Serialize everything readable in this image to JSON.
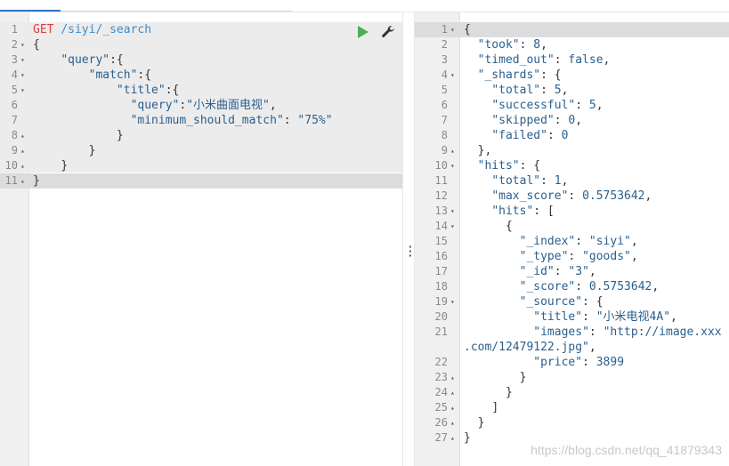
{
  "request": {
    "lines": [
      {
        "n": "1",
        "fold": "",
        "segs": [
          [
            "GET",
            "k-method"
          ],
          [
            " ",
            ""
          ],
          [
            "/siyi/_search",
            "k-url"
          ]
        ]
      },
      {
        "n": "2",
        "fold": "▾",
        "segs": [
          [
            "{",
            "k-punc"
          ]
        ]
      },
      {
        "n": "3",
        "fold": "▾",
        "segs": [
          [
            "    ",
            ""
          ],
          [
            "\"query\"",
            "k-key"
          ],
          [
            ":{",
            "k-punc"
          ]
        ]
      },
      {
        "n": "4",
        "fold": "▾",
        "segs": [
          [
            "        ",
            ""
          ],
          [
            "\"match\"",
            "k-key"
          ],
          [
            ":{",
            "k-punc"
          ]
        ]
      },
      {
        "n": "5",
        "fold": "▾",
        "segs": [
          [
            "            ",
            ""
          ],
          [
            "\"title\"",
            "k-key"
          ],
          [
            ":{",
            "k-punc"
          ]
        ]
      },
      {
        "n": "6",
        "fold": "",
        "segs": [
          [
            "              ",
            ""
          ],
          [
            "\"query\"",
            "k-key"
          ],
          [
            ":",
            "k-punc"
          ],
          [
            "\"小米曲面电视\"",
            "k-str"
          ],
          [
            ",",
            "k-punc"
          ]
        ]
      },
      {
        "n": "7",
        "fold": "",
        "segs": [
          [
            "              ",
            ""
          ],
          [
            "\"minimum_should_match\"",
            "k-key"
          ],
          [
            ": ",
            "k-punc"
          ],
          [
            "\"75%\"",
            "k-str"
          ]
        ]
      },
      {
        "n": "8",
        "fold": "▴",
        "segs": [
          [
            "            ",
            ""
          ],
          [
            "}",
            "k-punc"
          ]
        ]
      },
      {
        "n": "9",
        "fold": "▴",
        "segs": [
          [
            "        ",
            ""
          ],
          [
            "}",
            "k-punc"
          ]
        ]
      },
      {
        "n": "10",
        "fold": "▴",
        "segs": [
          [
            "    ",
            ""
          ],
          [
            "}",
            "k-punc"
          ]
        ]
      },
      {
        "n": "11",
        "fold": "▴",
        "segs": [
          [
            "}",
            "k-punc"
          ]
        ]
      }
    ]
  },
  "response": {
    "lines": [
      {
        "n": "1",
        "fold": "▾",
        "segs": [
          [
            "{",
            "k-punc"
          ]
        ]
      },
      {
        "n": "2",
        "fold": "",
        "segs": [
          [
            "  ",
            ""
          ],
          [
            "\"took\"",
            "k-key"
          ],
          [
            ": ",
            "k-punc"
          ],
          [
            "8",
            "k-num"
          ],
          [
            ",",
            "k-punc"
          ]
        ]
      },
      {
        "n": "3",
        "fold": "",
        "segs": [
          [
            "  ",
            ""
          ],
          [
            "\"timed_out\"",
            "k-key"
          ],
          [
            ": ",
            "k-punc"
          ],
          [
            "false",
            "k-bool"
          ],
          [
            ",",
            "k-punc"
          ]
        ]
      },
      {
        "n": "4",
        "fold": "▾",
        "segs": [
          [
            "  ",
            ""
          ],
          [
            "\"_shards\"",
            "k-key"
          ],
          [
            ": {",
            "k-punc"
          ]
        ]
      },
      {
        "n": "5",
        "fold": "",
        "segs": [
          [
            "    ",
            ""
          ],
          [
            "\"total\"",
            "k-key"
          ],
          [
            ": ",
            "k-punc"
          ],
          [
            "5",
            "k-num"
          ],
          [
            ",",
            "k-punc"
          ]
        ]
      },
      {
        "n": "6",
        "fold": "",
        "segs": [
          [
            "    ",
            ""
          ],
          [
            "\"successful\"",
            "k-key"
          ],
          [
            ": ",
            "k-punc"
          ],
          [
            "5",
            "k-num"
          ],
          [
            ",",
            "k-punc"
          ]
        ]
      },
      {
        "n": "7",
        "fold": "",
        "segs": [
          [
            "    ",
            ""
          ],
          [
            "\"skipped\"",
            "k-key"
          ],
          [
            ": ",
            "k-punc"
          ],
          [
            "0",
            "k-num"
          ],
          [
            ",",
            "k-punc"
          ]
        ]
      },
      {
        "n": "8",
        "fold": "",
        "segs": [
          [
            "    ",
            ""
          ],
          [
            "\"failed\"",
            "k-key"
          ],
          [
            ": ",
            "k-punc"
          ],
          [
            "0",
            "k-num"
          ]
        ]
      },
      {
        "n": "9",
        "fold": "▴",
        "segs": [
          [
            "  ",
            ""
          ],
          [
            "},",
            "k-punc"
          ]
        ]
      },
      {
        "n": "10",
        "fold": "▾",
        "segs": [
          [
            "  ",
            ""
          ],
          [
            "\"hits\"",
            "k-key"
          ],
          [
            ": {",
            "k-punc"
          ]
        ]
      },
      {
        "n": "11",
        "fold": "",
        "segs": [
          [
            "    ",
            ""
          ],
          [
            "\"total\"",
            "k-key"
          ],
          [
            ": ",
            "k-punc"
          ],
          [
            "1",
            "k-num"
          ],
          [
            ",",
            "k-punc"
          ]
        ]
      },
      {
        "n": "12",
        "fold": "",
        "segs": [
          [
            "    ",
            ""
          ],
          [
            "\"max_score\"",
            "k-key"
          ],
          [
            ": ",
            "k-punc"
          ],
          [
            "0.5753642",
            "k-num"
          ],
          [
            ",",
            "k-punc"
          ]
        ]
      },
      {
        "n": "13",
        "fold": "▾",
        "segs": [
          [
            "    ",
            ""
          ],
          [
            "\"hits\"",
            "k-key"
          ],
          [
            ": [",
            "k-punc"
          ]
        ]
      },
      {
        "n": "14",
        "fold": "▾",
        "segs": [
          [
            "      ",
            ""
          ],
          [
            "{",
            "k-punc"
          ]
        ]
      },
      {
        "n": "15",
        "fold": "",
        "segs": [
          [
            "        ",
            ""
          ],
          [
            "\"_index\"",
            "k-key"
          ],
          [
            ": ",
            "k-punc"
          ],
          [
            "\"siyi\"",
            "k-str"
          ],
          [
            ",",
            "k-punc"
          ]
        ]
      },
      {
        "n": "16",
        "fold": "",
        "segs": [
          [
            "        ",
            ""
          ],
          [
            "\"_type\"",
            "k-key"
          ],
          [
            ": ",
            "k-punc"
          ],
          [
            "\"goods\"",
            "k-str"
          ],
          [
            ",",
            "k-punc"
          ]
        ]
      },
      {
        "n": "17",
        "fold": "",
        "segs": [
          [
            "        ",
            ""
          ],
          [
            "\"_id\"",
            "k-key"
          ],
          [
            ": ",
            "k-punc"
          ],
          [
            "\"3\"",
            "k-str"
          ],
          [
            ",",
            "k-punc"
          ]
        ]
      },
      {
        "n": "18",
        "fold": "",
        "segs": [
          [
            "        ",
            ""
          ],
          [
            "\"_score\"",
            "k-key"
          ],
          [
            ": ",
            "k-punc"
          ],
          [
            "0.5753642",
            "k-num"
          ],
          [
            ",",
            "k-punc"
          ]
        ]
      },
      {
        "n": "19",
        "fold": "▾",
        "segs": [
          [
            "        ",
            ""
          ],
          [
            "\"_source\"",
            "k-key"
          ],
          [
            ": {",
            "k-punc"
          ]
        ]
      },
      {
        "n": "20",
        "fold": "",
        "segs": [
          [
            "          ",
            ""
          ],
          [
            "\"title\"",
            "k-key"
          ],
          [
            ": ",
            "k-punc"
          ],
          [
            "\"小米电视4A\"",
            "k-str"
          ],
          [
            ",",
            "k-punc"
          ]
        ]
      },
      {
        "n": "21",
        "fold": "",
        "segs": [
          [
            "          ",
            ""
          ],
          [
            "\"images\"",
            "k-key"
          ],
          [
            ": ",
            "k-punc"
          ],
          [
            "\"http://image.xxx",
            "k-str"
          ]
        ]
      },
      {
        "n": "",
        "fold": "",
        "segs": [
          [
            ".com/12479122.jpg\"",
            "k-str"
          ],
          [
            ",",
            "k-punc"
          ]
        ]
      },
      {
        "n": "22",
        "fold": "",
        "segs": [
          [
            "          ",
            ""
          ],
          [
            "\"price\"",
            "k-key"
          ],
          [
            ": ",
            "k-punc"
          ],
          [
            "3899",
            "k-num"
          ]
        ]
      },
      {
        "n": "23",
        "fold": "▴",
        "segs": [
          [
            "        ",
            ""
          ],
          [
            "}",
            "k-punc"
          ]
        ]
      },
      {
        "n": "24",
        "fold": "▴",
        "segs": [
          [
            "      ",
            ""
          ],
          [
            "}",
            "k-punc"
          ]
        ]
      },
      {
        "n": "25",
        "fold": "▴",
        "segs": [
          [
            "    ",
            ""
          ],
          [
            "]",
            "k-punc"
          ]
        ]
      },
      {
        "n": "26",
        "fold": "▴",
        "segs": [
          [
            "  ",
            ""
          ],
          [
            "}",
            "k-punc"
          ]
        ]
      },
      {
        "n": "27",
        "fold": "▴",
        "segs": [
          [
            "}",
            "k-punc"
          ]
        ]
      }
    ]
  },
  "watermark": "https://blog.csdn.net/qq_41879343"
}
